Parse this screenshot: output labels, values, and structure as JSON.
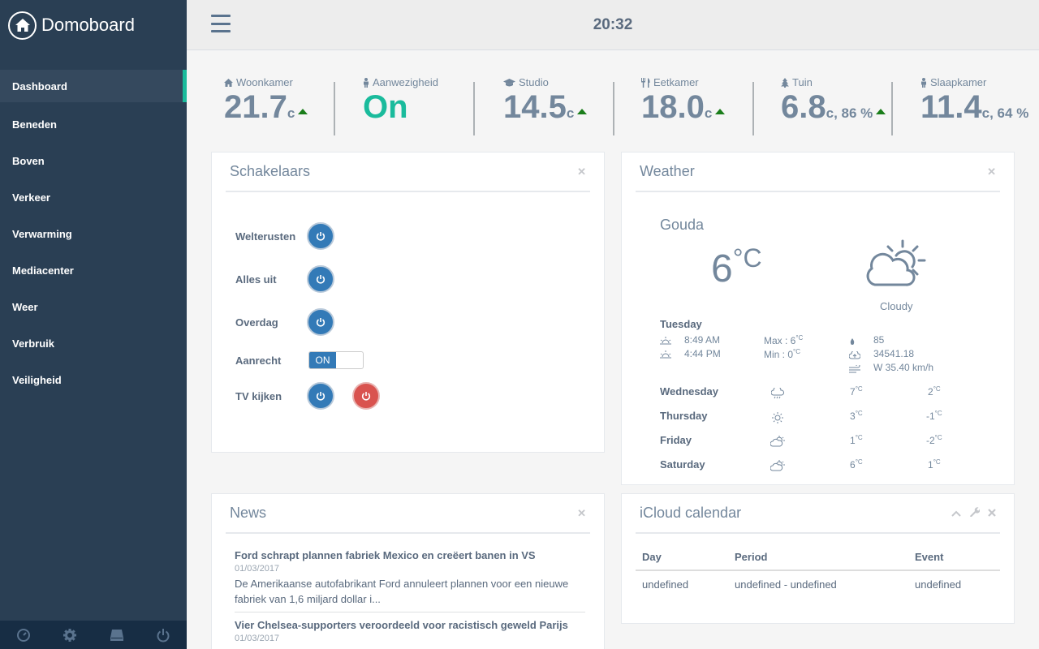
{
  "app": {
    "title": "Domoboard"
  },
  "header": {
    "time": "20:32"
  },
  "sidebar": {
    "items": [
      {
        "label": "Dashboard",
        "active": true
      },
      {
        "label": "Beneden"
      },
      {
        "label": "Boven"
      },
      {
        "label": "Verkeer"
      },
      {
        "label": "Verwarming"
      },
      {
        "label": "Mediacenter"
      },
      {
        "label": "Weer"
      },
      {
        "label": "Verbruik"
      },
      {
        "label": "Veiligheid"
      }
    ],
    "footer_icons": [
      "dashboard-icon",
      "gear-icon",
      "hdd-icon",
      "power-icon"
    ]
  },
  "stats": [
    {
      "label": "Woonkamer",
      "icon": "home-icon",
      "value": "21.7",
      "unit": "c"
    },
    {
      "label": "Aanwezigheid",
      "icon": "person-icon",
      "value": "On"
    },
    {
      "label": "Studio",
      "icon": "graduation-cap-icon",
      "value": "14.5",
      "unit": "c"
    },
    {
      "label": "Eetkamer",
      "icon": "cutlery-icon",
      "value": "18.0",
      "unit": "c"
    },
    {
      "label": "Tuin",
      "icon": "tree-icon",
      "value": "6.8",
      "unit": "c, 86 %"
    },
    {
      "label": "Slaapkamer",
      "icon": "person-icon",
      "value": "11.4",
      "unit": "c, 64 %"
    }
  ],
  "switches": {
    "title": "Schakelaars",
    "close": "✕",
    "rows": [
      {
        "label": "Welterusten"
      },
      {
        "label": "Alles uit"
      },
      {
        "label": "Overdag"
      },
      {
        "label": "Aanrecht",
        "toggle": "ON"
      },
      {
        "label": "TV kijken"
      }
    ]
  },
  "weather": {
    "title": "Weather",
    "close": "✕",
    "city": "Gouda",
    "temp": "6",
    "temp_unit": "°C",
    "condition": "Cloudy",
    "today": {
      "day": "Tuesday",
      "sunrise": "8:49 AM",
      "sunset": "4:44 PM",
      "max_label": "Max : 6",
      "min_label": "Min : 0",
      "deg": "°C",
      "humidity": "85",
      "pressure": "34541.18",
      "wind": "W 35.40 km/h"
    },
    "forecast": [
      {
        "day": "Wednesday",
        "high": "7",
        "low": "2",
        "icon": "rain-cloud-icon"
      },
      {
        "day": "Thursday",
        "high": "3",
        "low": "-1",
        "icon": "sun-icon"
      },
      {
        "day": "Friday",
        "high": "1",
        "low": "-2",
        "icon": "partly-cloudy-icon"
      },
      {
        "day": "Saturday",
        "high": "6",
        "low": "1",
        "icon": "partly-cloudy-icon"
      }
    ]
  },
  "news": {
    "title": "News",
    "close": "✕",
    "items": [
      {
        "title": "Ford schrapt plannen fabriek Mexico en creëert banen in VS",
        "date": "01/03/2017",
        "summary": "De Amerikaanse autofabrikant Ford annuleert plannen voor een nieuwe fabriek van 1,6 miljard dollar i..."
      },
      {
        "title": "Vier Chelsea-supporters veroordeeld voor racistisch geweld Parijs",
        "date": "01/03/2017",
        "summary": ""
      }
    ]
  },
  "calendar": {
    "title": "iCloud calendar",
    "columns": [
      "Day",
      "Period",
      "Event"
    ],
    "rows": [
      [
        "undefined",
        "undefined - undefined",
        "undefined"
      ]
    ]
  },
  "colors": {
    "sidebar": "#2a3f54",
    "accent": "#1abb9c",
    "primary": "#337ab7",
    "danger": "#d9534f"
  }
}
